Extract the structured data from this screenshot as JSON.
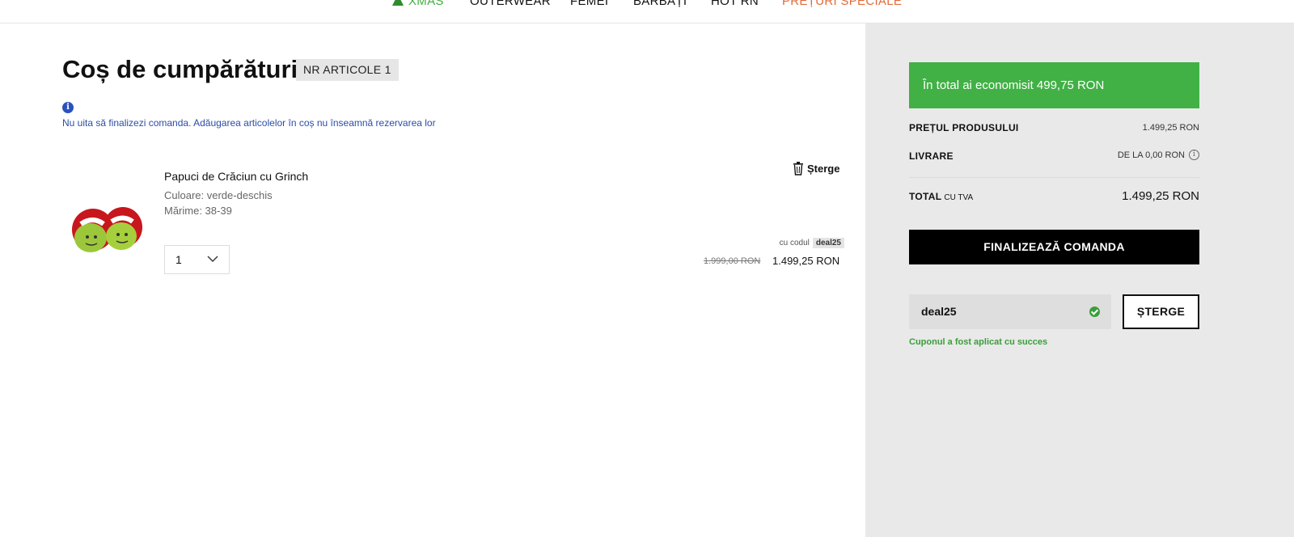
{
  "nav": {
    "items": [
      {
        "label": "XMAS",
        "icon": "tree-icon",
        "color": "#3fae3f"
      },
      {
        "label": "OUTERWEAR"
      },
      {
        "label": "FEMEI"
      },
      {
        "label": "BĂRBAȚI"
      },
      {
        "label": "HOT RN"
      },
      {
        "label": "PREȚURI SPECIALE",
        "color": "#e26b3a"
      }
    ]
  },
  "cart": {
    "title": "Coș de cumpărături",
    "count_badge": "NR ARTICOLE 1",
    "info_icon": "info-icon",
    "info_text": "Nu uita să finalizezi comanda. Adăugarea articolelor în coș nu înseamnă rezervarea lor",
    "item": {
      "name": "Papuci de Crăciun cu Grinch",
      "color": "Culoare: verde-deschis",
      "size": "Mărime: 38-39",
      "remove_label": "Șterge",
      "quantity": "1",
      "coupon_prefix": "cu codul",
      "coupon_code": "deal25",
      "old_price": "1.999,00 RON",
      "new_price": "1.499,25 RON"
    }
  },
  "summary": {
    "savings": "În total ai economisit 499,75 RON",
    "product_price_label": "PREȚUL PRODUSULUI",
    "product_price_value": "1.499,25 RON",
    "delivery_label": "LIVRARE",
    "delivery_value": "DE LA 0,00 RON",
    "total_label": "TOTAL",
    "total_sublabel": "CU TVA",
    "total_value": "1.499,25 RON",
    "checkout_label": "FINALIZEAZĂ COMANDA",
    "coupon_value": "deal25",
    "coupon_remove_label": "ȘTERGE",
    "coupon_success": "Cuponul a fost aplicat cu succes"
  },
  "colors": {
    "accent_green": "#41b045",
    "info_blue": "#2a4da8",
    "summary_bg": "#e9e9e9"
  }
}
